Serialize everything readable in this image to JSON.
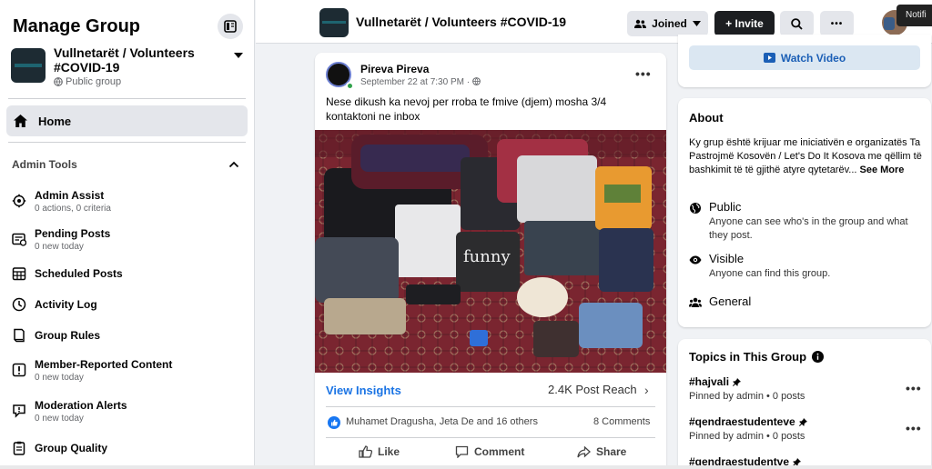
{
  "sidebar": {
    "title": "Manage Group",
    "group": {
      "name": "Vullnetarët / Volunteers #COVID-19",
      "privacy": "Public group"
    },
    "home_label": "Home",
    "admin_tools_label": "Admin Tools",
    "items": [
      {
        "label": "Admin Assist",
        "sub": "0 actions, 0 criteria",
        "icon": "admin-assist-icon"
      },
      {
        "label": "Pending Posts",
        "sub": "0 new today",
        "icon": "pending-posts-icon"
      },
      {
        "label": "Scheduled Posts",
        "sub": "",
        "icon": "scheduled-posts-icon"
      },
      {
        "label": "Activity Log",
        "sub": "",
        "icon": "activity-log-icon"
      },
      {
        "label": "Group Rules",
        "sub": "",
        "icon": "group-rules-icon"
      },
      {
        "label": "Member-Reported Content",
        "sub": "0 new today",
        "icon": "report-icon"
      },
      {
        "label": "Moderation Alerts",
        "sub": "0 new today",
        "icon": "moderation-alerts-icon"
      },
      {
        "label": "Group Quality",
        "sub": "",
        "icon": "group-quality-icon"
      }
    ]
  },
  "topbar": {
    "title": "Vullnetarët / Volunteers #COVID-19",
    "joined_label": "Joined",
    "invite_label": "+ Invite",
    "more_label": "•••",
    "notification_label": "Notifi"
  },
  "post": {
    "author": "Pireva Pireva",
    "time": "September 22 at 7:30 PM · ",
    "text": "Nese dikush ka nevoj per rroba te fmive (djem) mosha 3/4 kontaktoni ne inbox",
    "insights_label": "View Insights",
    "reach_label": "2.4K Post Reach",
    "reactions": "Muhamet Dragusha, Jeta De and 16 others",
    "comments": "8 Comments",
    "actions": {
      "like": "Like",
      "comment": "Comment",
      "share": "Share"
    },
    "more_label": "•••"
  },
  "right": {
    "watch_video_label": "Watch Video",
    "about": {
      "title": "About",
      "description": "Ky grup është krijuar me iniciativën e organizatës Ta Pastrojmë Kosovën / Let's Do It Kosova me qëllim të bashkimit të të gjithë atyre qytetarëv...",
      "see_more": "See More",
      "public_title": "Public",
      "public_desc": "Anyone can see who's in the group and what they post.",
      "visible_title": "Visible",
      "visible_desc": "Anyone can find this group.",
      "general_label": "General"
    },
    "topics": {
      "title": "Topics in This Group",
      "items": [
        {
          "name": "#hajvali",
          "meta": "Pinned by admin • 0 posts"
        },
        {
          "name": "#qendraestudenteve",
          "meta": "Pinned by admin • 0 posts"
        },
        {
          "name": "#qendraestudentve",
          "meta": ""
        }
      ]
    }
  },
  "colors": {
    "accent": "#1b74e4",
    "online": "#31a24c",
    "dark_button": "#1c1e21"
  }
}
